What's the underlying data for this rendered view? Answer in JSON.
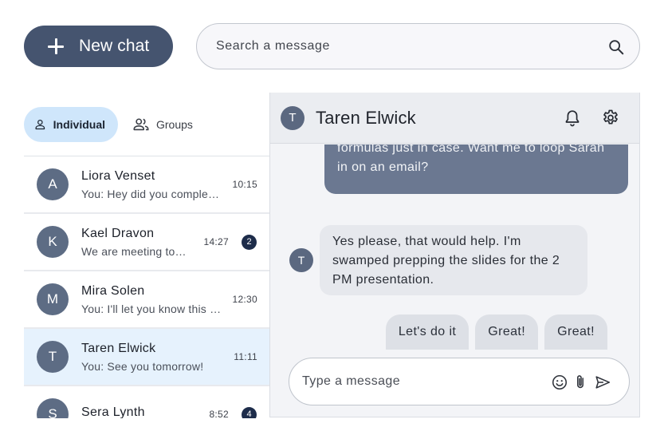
{
  "toolbar": {
    "new_chat_label": "New chat",
    "search_placeholder": "Search a message"
  },
  "tabs": [
    {
      "label": "Individual",
      "active": true,
      "icon": "person-icon"
    },
    {
      "label": "Groups",
      "active": false,
      "icon": "group-icon"
    }
  ],
  "conversations": [
    {
      "initial": "A",
      "name": "Liora Venset",
      "preview": "You: Hey did you complete the report?",
      "time": "10:15",
      "badge": ""
    },
    {
      "initial": "K",
      "name": "Kael Dravon",
      "preview": "We are meeting tomorrow",
      "time": "14:27",
      "badge": "2"
    },
    {
      "initial": "M",
      "name": "Mira Solen",
      "preview": "You: I'll let you know this afternoon",
      "time": "12:30",
      "badge": ""
    },
    {
      "initial": "T",
      "name": "Taren Elwick",
      "preview": "You: See you tomorrow!",
      "time": "11:11",
      "badge": ""
    },
    {
      "initial": "S",
      "name": "Sera Lynth",
      "preview": "",
      "time": "8:52",
      "badge": "4"
    }
  ],
  "chat": {
    "contact_initial": "T",
    "contact_name": "Taren Elwick",
    "outgoing_lines": [
      "formulas just in case. Want me to loop Sarah",
      "in on an email?"
    ],
    "incoming_lines": [
      "Yes please, that would help. I'm",
      "swamped prepping the slides for the 2",
      "PM presentation."
    ],
    "suggestions": [
      "Let's do it",
      "Great!",
      "Great!"
    ],
    "composer_placeholder": "Type a message"
  },
  "icons": {
    "search": "search-icon",
    "bell": "bell-icon",
    "settings": "gear-icon",
    "emoji": "emoji-icon",
    "attach": "paperclip-icon",
    "send": "send-icon"
  },
  "colors": {
    "primary": "#45546f",
    "tab_active": "#cfe6fb",
    "row_active": "#e6f2fd",
    "bubble_out": "#6b7891",
    "badge": "#1d2c4a"
  }
}
